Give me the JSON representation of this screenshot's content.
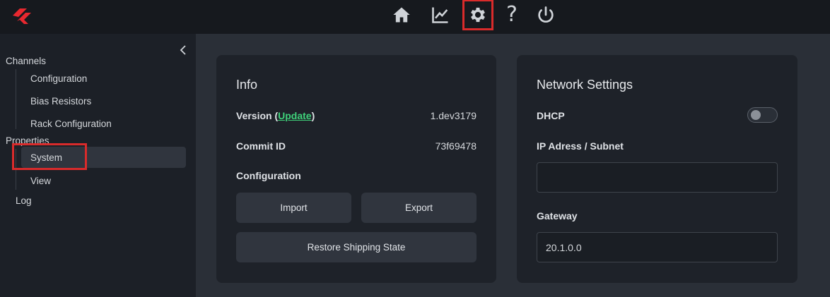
{
  "topbar": {
    "nav": [
      {
        "icon": "home-icon"
      },
      {
        "icon": "chart-icon"
      },
      {
        "icon": "gear-icon",
        "active": true
      },
      {
        "icon": "help-icon",
        "label": "?"
      },
      {
        "icon": "power-icon"
      }
    ],
    "brand_color": "#e8282f"
  },
  "sidebar": {
    "groups": [
      {
        "label": "Channels",
        "items": [
          "Configuration",
          "Bias Resistors",
          "Rack Configuration"
        ]
      },
      {
        "label": "Properties",
        "items": [
          "System",
          "View"
        ]
      }
    ],
    "selected": "System",
    "log_label": "Log"
  },
  "info": {
    "title": "Info",
    "version_label_pre": "Version (",
    "version_link": "Update",
    "version_label_post": ")",
    "version_value": "1.dev3179",
    "commit_label": "Commit ID",
    "commit_value": "73f69478",
    "configuration_label": "Configuration",
    "import_button": "Import",
    "export_button": "Export",
    "restore_button": "Restore Shipping State"
  },
  "network": {
    "title": "Network Settings",
    "dhcp_label": "DHCP",
    "dhcp_enabled": false,
    "ip_label": "IP Adress / Subnet",
    "ip_value": "",
    "gateway_label": "Gateway",
    "gateway_value": "20.1.0.0"
  },
  "colors": {
    "link": "#3fd17a",
    "highlight": "#d92b2b"
  }
}
